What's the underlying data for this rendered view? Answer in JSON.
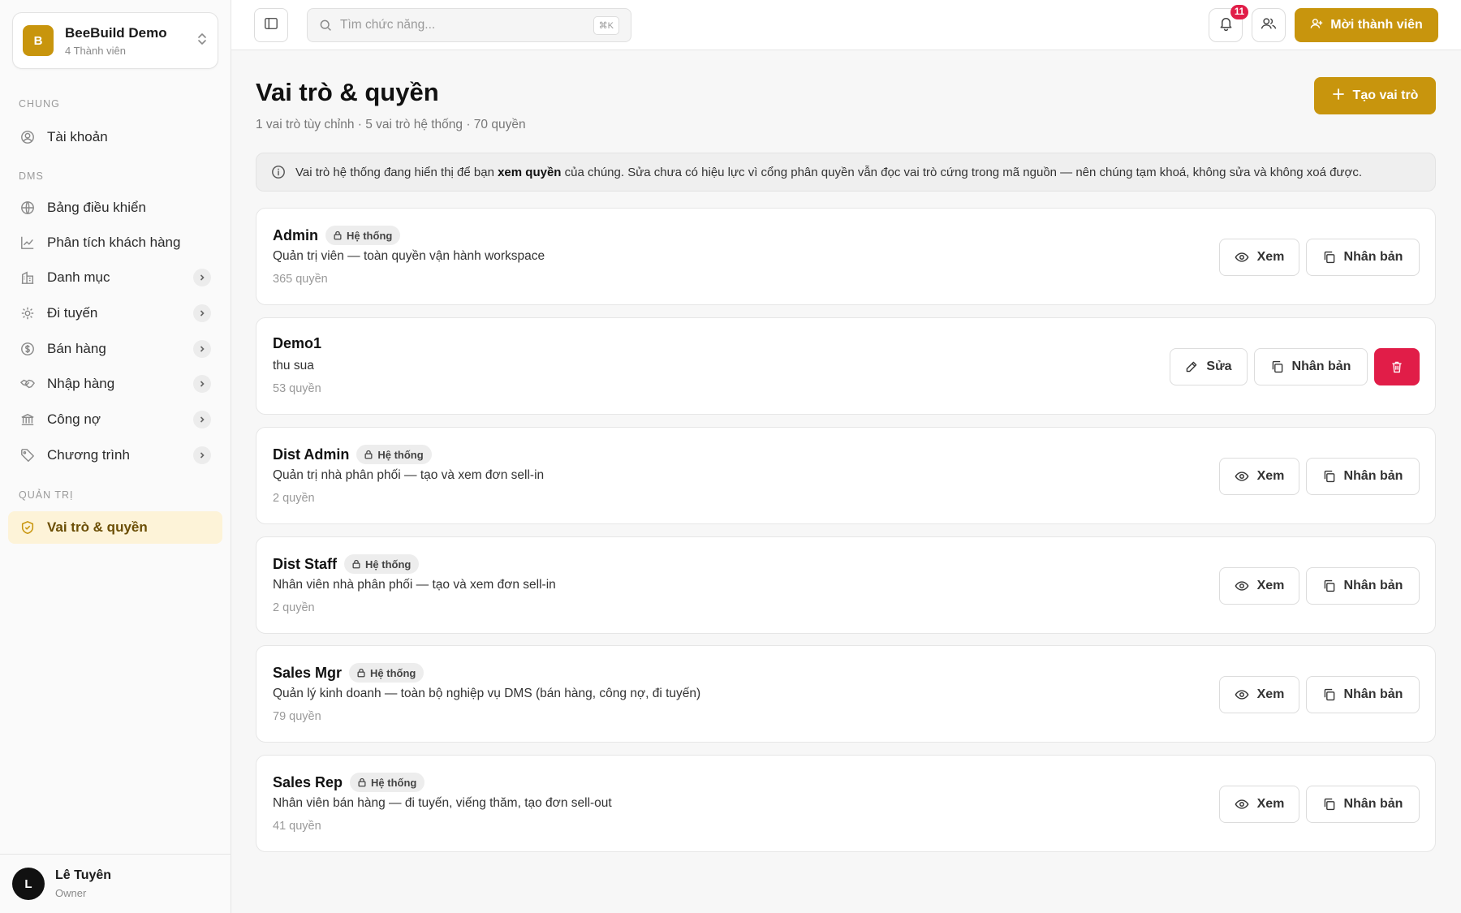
{
  "workspace": {
    "logo_letter": "B",
    "name": "BeeBuild Demo",
    "members": "4 Thành viên"
  },
  "nav": {
    "section_general": "CHUNG",
    "account": "Tài khoản",
    "section_dms": "DMS",
    "dashboard": "Bảng điều khiển",
    "customer_analytics": "Phân tích khách hàng",
    "catalog": "Danh mục",
    "routes": "Đi tuyến",
    "sales": "Bán hàng",
    "purchasing": "Nhập hàng",
    "debt": "Công nợ",
    "programs": "Chương trình",
    "section_admin": "QUẢN TRỊ",
    "roles": "Vai trò & quyền"
  },
  "user": {
    "initial": "L",
    "name": "Lê Tuyên",
    "role": "Owner"
  },
  "topbar": {
    "search_placeholder": "Tìm chức năng...",
    "search_shortcut": "⌘K",
    "notification_count": "11",
    "invite_label": "Mời thành viên"
  },
  "page": {
    "title": "Vai trò & quyền",
    "subtitle": "1 vai trò tùy chỉnh · 5 vai trò hệ thống · 70 quyền",
    "create_label": "Tạo vai trò",
    "notice_before": "Vai trò hệ thống đang hiển thị để bạn ",
    "notice_bold": "xem quyền",
    "notice_after": " của chúng. Sửa chưa có hiệu lực vì cổng phân quyền vẫn đọc vai trò cứng trong mã nguồn — nên chúng tạm khoá, không sửa và không xoá được."
  },
  "labels": {
    "system": "Hệ thống",
    "view": "Xem",
    "duplicate": "Nhân bản",
    "edit": "Sửa"
  },
  "roles": [
    {
      "name": "Admin",
      "system": true,
      "desc": "Quản trị viên — toàn quyền vận hành workspace",
      "count": "365 quyền"
    },
    {
      "name": "Demo1",
      "system": false,
      "desc": "thu sua",
      "count": "53 quyền"
    },
    {
      "name": "Dist Admin",
      "system": true,
      "desc": "Quản trị nhà phân phối — tạo và xem đơn sell-in",
      "count": "2 quyền"
    },
    {
      "name": "Dist Staff",
      "system": true,
      "desc": "Nhân viên nhà phân phối — tạo và xem đơn sell-in",
      "count": "2 quyền"
    },
    {
      "name": "Sales Mgr",
      "system": true,
      "desc": "Quản lý kinh doanh — toàn bộ nghiệp vụ DMS (bán hàng, công nợ, đi tuyến)",
      "count": "79 quyền"
    },
    {
      "name": "Sales Rep",
      "system": true,
      "desc": "Nhân viên bán hàng — đi tuyến, viếng thăm, tạo đơn sell-out",
      "count": "41 quyền"
    }
  ],
  "colors": {
    "accent": "#c8950d",
    "danger": "#e11d48",
    "active_bg": "#fdf3d8"
  }
}
